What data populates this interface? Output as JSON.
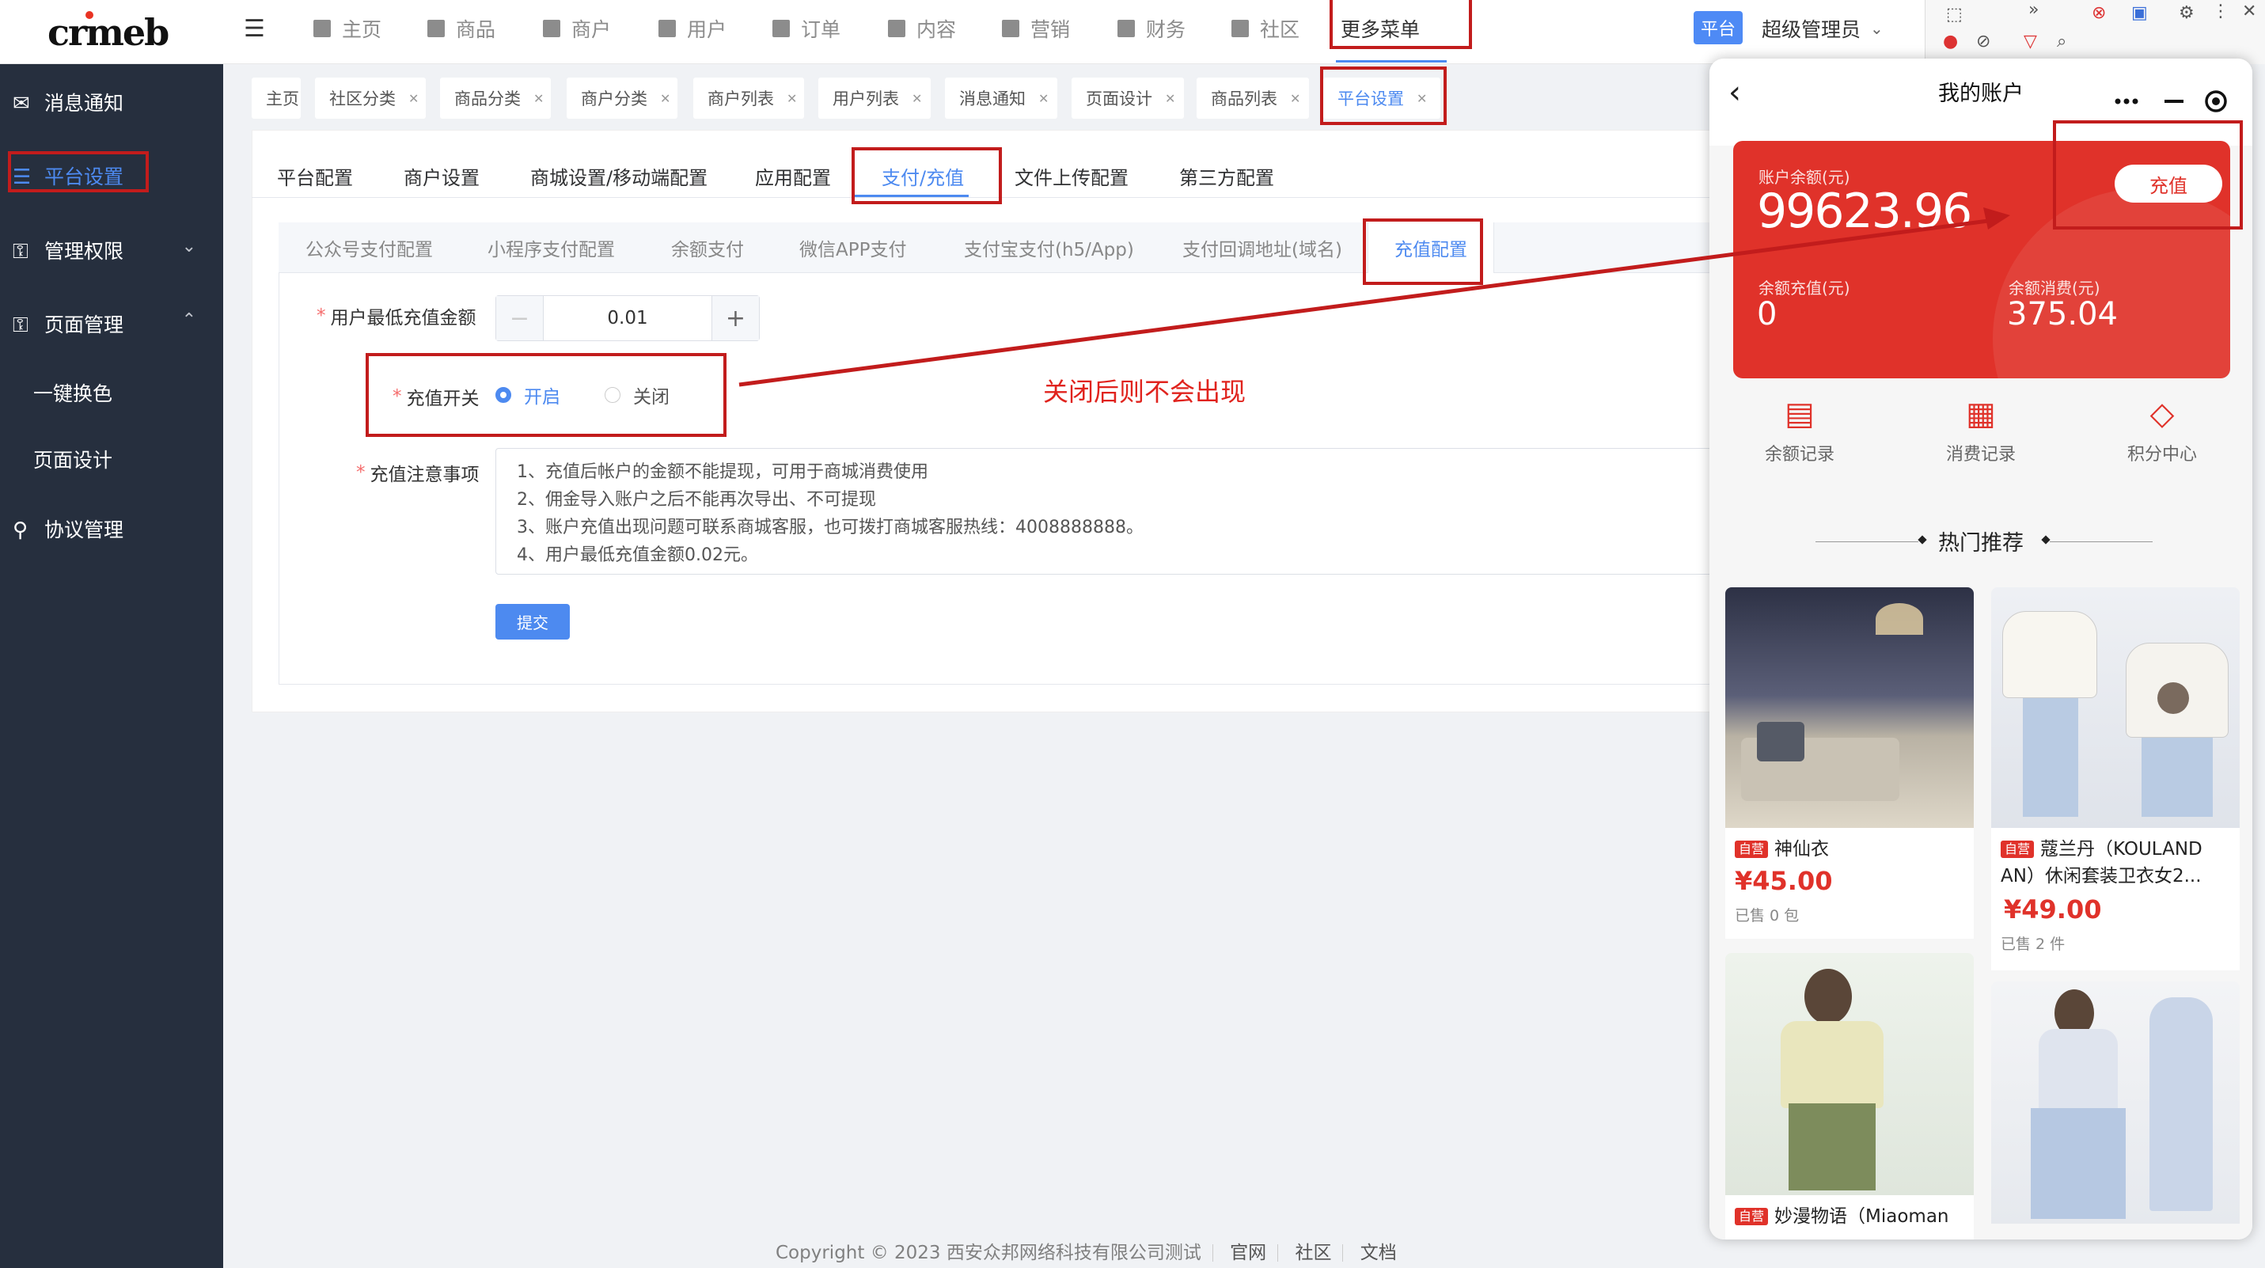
{
  "logo": "crmeb",
  "nav": {
    "items": [
      "主页",
      "商品",
      "商户",
      "用户",
      "订单",
      "内容",
      "营销",
      "财务",
      "社区"
    ],
    "more": "更多菜单",
    "badge": "平台",
    "admin": "超级管理员"
  },
  "sidebar": {
    "items": [
      "消息通知",
      "平台设置",
      "管理权限",
      "页面管理",
      "一键换色",
      "页面设计",
      "协议管理"
    ]
  },
  "tabs": [
    "主页",
    "社区分类",
    "商品分类",
    "商户分类",
    "商户列表",
    "用户列表",
    "消息通知",
    "页面设计",
    "商品列表",
    "平台设置"
  ],
  "section_tabs": [
    "平台配置",
    "商户设置",
    "商城设置/移动端配置",
    "应用配置",
    "支付/充值",
    "文件上传配置",
    "第三方配置"
  ],
  "sub_tabs": [
    "公众号支付配置",
    "小程序支付配置",
    "余额支付",
    "微信APP支付",
    "支付宝支付(h5/App)",
    "支付回调地址(域名)",
    "充值配置"
  ],
  "form": {
    "min_label": "用户最低充值金额",
    "min_value": "0.01",
    "switch_label": "充值开关",
    "on": "开启",
    "off": "关闭",
    "notes_label": "充值注意事项",
    "notes": [
      "1、充值后帐户的金额不能提现，可用于商城消费使用",
      "2、佣金导入账户之后不能再次导出、不可提现",
      "3、账户充值出现问题可联系商城客服，也可拨打商城客服热线：4008888888。",
      "4、用户最低充值金额0.02元。"
    ],
    "submit": "提交"
  },
  "annotation": "关闭后则不会出现",
  "footer": {
    "copyright": "Copyright © 2023 西安众邦网络科技有限公司测试",
    "links": [
      "官网",
      "社区",
      "文档"
    ]
  },
  "phone": {
    "title": "我的账户",
    "balance_label": "账户余额(元)",
    "balance": "99623.96",
    "recharge_btn": "充值",
    "recharged_label": "余额充值(元)",
    "recharged": "0",
    "consumed_label": "余额消费(元)",
    "consumed": "375.04",
    "shortcuts": [
      "余额记录",
      "消费记录",
      "积分中心"
    ],
    "hot_title": "热门推荐",
    "tag": "自营",
    "goods": [
      {
        "name": "神仙衣",
        "price": "¥45.00",
        "sold": "已售 0 包"
      },
      {
        "name": "蔻兰丹（KOULAND AN）休闲套装卫衣女2...",
        "price": "¥49.00",
        "sold": "已售 2 件"
      },
      {
        "name": "妙漫物语（Miaoman",
        "price": "",
        "sold": ""
      }
    ]
  },
  "colors": {
    "accent": "#4d8af0",
    "brand_red": "#e0322a",
    "sidebar": "#262f3e",
    "annotation": "#c21c1c"
  }
}
